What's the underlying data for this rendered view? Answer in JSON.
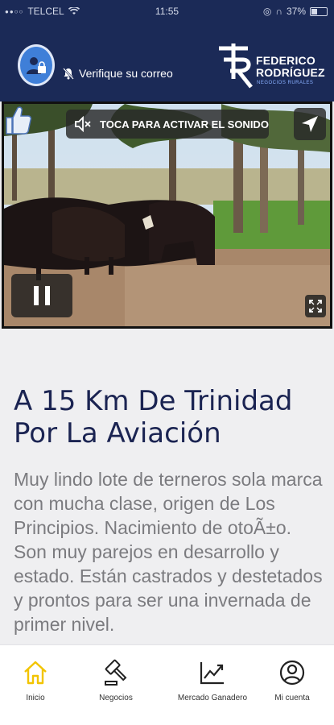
{
  "status_bar": {
    "carrier": "TELCEL",
    "time": "11:55",
    "battery": "37%"
  },
  "header": {
    "verify_text": "Verifique su correo",
    "logo_line1": "FEDERICO",
    "logo_line2": "RODRÍGUEZ",
    "logo_sub": "NEGOCIOS RURALES"
  },
  "video": {
    "sound_label": "TOCA PARA ACTIVAR EL SONIDO"
  },
  "listing": {
    "title": "A 15 Km De Trinidad Por La Aviación",
    "description": "Muy lindo lote de terneros sola marca con mucha clase, origen de Los Principios. Nacimiento de otoÃ±o. Son muy parejos en desarrollo y estado. Están castrados y destetados y prontos para ser una invernada de primer nivel."
  },
  "tabbar": {
    "items": [
      {
        "label": "Inicio",
        "icon": "home-icon",
        "active": true
      },
      {
        "label": "Negocios",
        "icon": "gavel-icon",
        "active": false
      },
      {
        "label": "Mercado Ganadero",
        "icon": "chart-icon",
        "active": false
      },
      {
        "label": "Mi cuenta",
        "icon": "account-icon",
        "active": false
      }
    ]
  },
  "colors": {
    "header_bg": "#1b2a57",
    "title": "#1b2452",
    "active_tab": "#f2c400"
  }
}
